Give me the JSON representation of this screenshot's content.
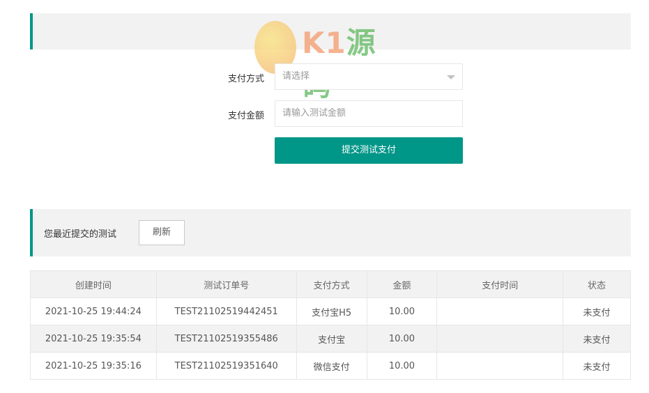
{
  "logo": {
    "brand": "K1",
    "brand_cn": "源码",
    "url": "k1ym.com"
  },
  "form": {
    "pay_method_label": "支付方式",
    "pay_method_placeholder": "请选择",
    "amount_label": "支付金额",
    "amount_placeholder": "请输入测试金额",
    "submit_label": "提交测试支付"
  },
  "recent": {
    "title": "您最近提交的测试",
    "refresh_label": "刷新"
  },
  "colors": {
    "accent": "#009688"
  },
  "table": {
    "headers": [
      "创建时间",
      "测试订单号",
      "支付方式",
      "金额",
      "支付时间",
      "状态"
    ],
    "rows": [
      [
        "2021-10-25 19:44:24",
        "TEST21102519442451",
        "支付宝H5",
        "10.00",
        "",
        "未支付"
      ],
      [
        "2021-10-25 19:35:54",
        "TEST21102519355486",
        "支付宝",
        "10.00",
        "",
        "未支付"
      ],
      [
        "2021-10-25 19:35:16",
        "TEST21102519351640",
        "微信支付",
        "10.00",
        "",
        "未支付"
      ]
    ]
  }
}
